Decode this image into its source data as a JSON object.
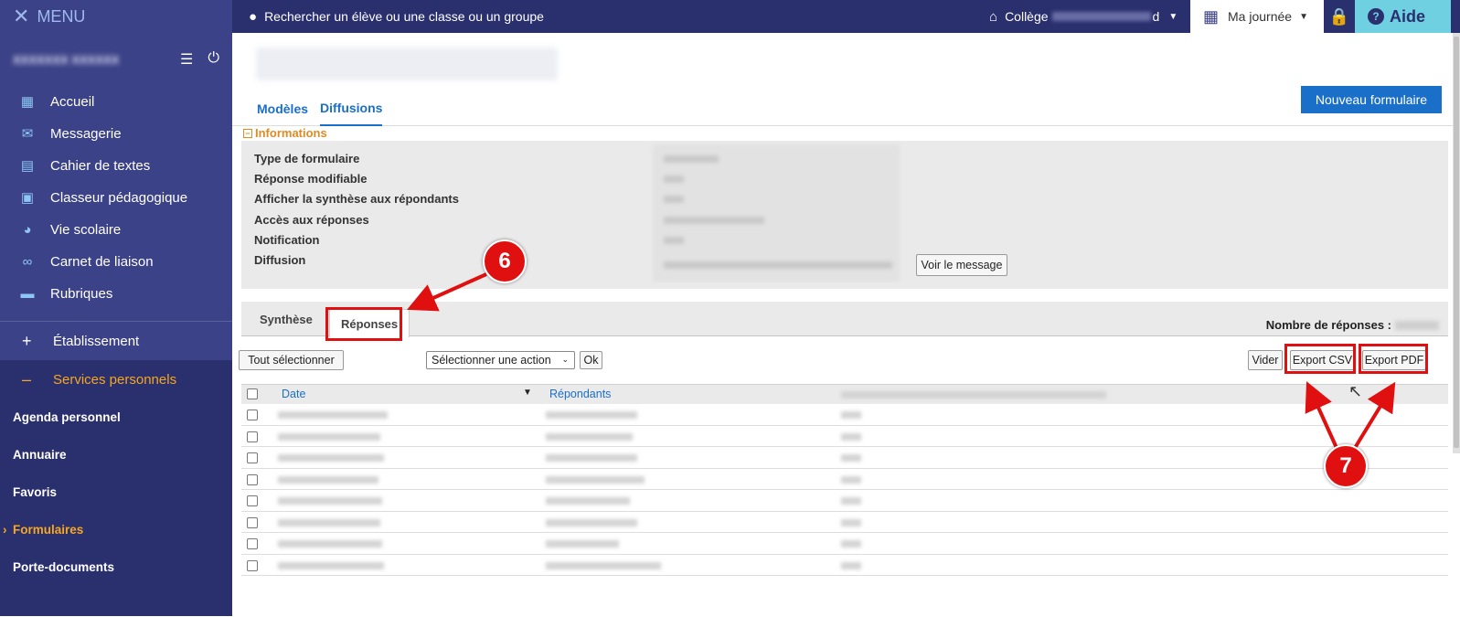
{
  "sidebar": {
    "menu_label": "MENU",
    "user_name": "XXXXXXX XXXXXX",
    "nav": [
      {
        "label": "Accueil",
        "icon": "grid-icon"
      },
      {
        "label": "Messagerie",
        "icon": "envelope-icon"
      },
      {
        "label": "Cahier de textes",
        "icon": "book-icon"
      },
      {
        "label": "Classeur pédagogique",
        "icon": "binder-icon"
      },
      {
        "label": "Vie scolaire",
        "icon": "pie-icon"
      },
      {
        "label": "Carnet de liaison",
        "icon": "link-icon"
      },
      {
        "label": "Rubriques",
        "icon": "comment-icon"
      }
    ],
    "etablissement": "Établissement",
    "services": "Services personnels",
    "sub_items": [
      "Agenda personnel",
      "Annuaire",
      "Favoris",
      "Formulaires",
      "Porte-documents"
    ]
  },
  "topbar": {
    "search_placeholder": "Rechercher un élève ou une classe ou un groupe",
    "college_prefix": "Collège",
    "college_suffix": "d",
    "journee": "Ma journée",
    "aide": "Aide"
  },
  "page": {
    "tabs": [
      "Modèles",
      "Diffusions"
    ],
    "new_button": "Nouveau formulaire",
    "info_title": "Informations",
    "info_labels": [
      "Type de formulaire",
      "Réponse modifiable",
      "Afficher la synthèse aux répondants",
      "Accès aux réponses",
      "Notification",
      "Diffusion"
    ],
    "voir_message": "Voir le message",
    "sub_tabs": [
      "Synthèse",
      "Réponses"
    ],
    "count_label": "Nombre de réponses :",
    "tout_selectionner": "Tout sélectionner",
    "action_select": "Sélectionner une action",
    "ok": "Ok",
    "vider": "Vider",
    "export_csv": "Export CSV",
    "export_pdf": "Export PDF",
    "columns": [
      "Date",
      "Répondants"
    ],
    "row_count": 8
  },
  "annotations": {
    "badge_6": "6",
    "badge_7": "7",
    "color": "#e01010"
  }
}
